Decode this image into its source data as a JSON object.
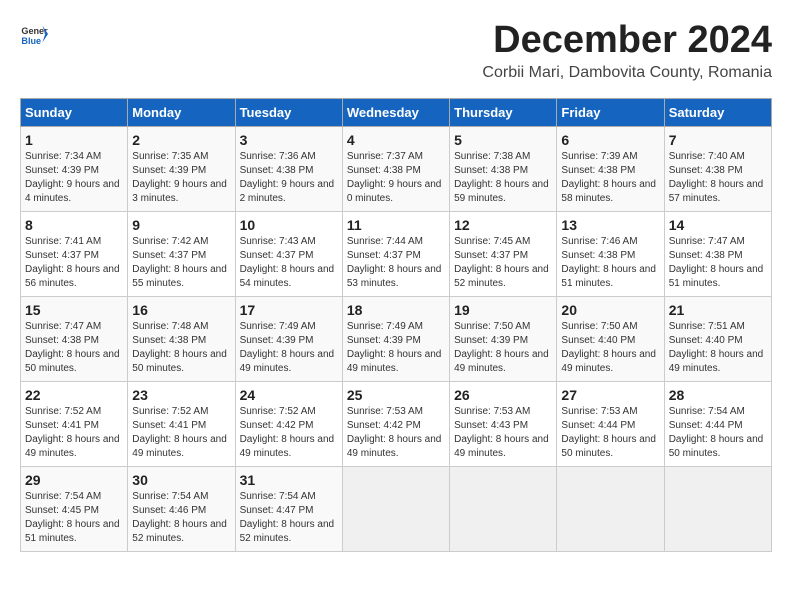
{
  "header": {
    "logo_general": "General",
    "logo_blue": "Blue",
    "month_title": "December 2024",
    "location": "Corbii Mari, Dambovita County, Romania"
  },
  "calendar": {
    "days_of_week": [
      "Sunday",
      "Monday",
      "Tuesday",
      "Wednesday",
      "Thursday",
      "Friday",
      "Saturday"
    ],
    "weeks": [
      [
        null,
        null,
        null,
        null,
        null,
        null,
        null
      ]
    ],
    "cells": [
      {
        "day": null,
        "info": null
      },
      {
        "day": null,
        "info": null
      },
      {
        "day": null,
        "info": null
      },
      {
        "day": null,
        "info": null
      },
      {
        "day": null,
        "info": null
      },
      {
        "day": null,
        "info": null
      },
      {
        "day": null,
        "info": null
      }
    ],
    "rows": [
      [
        {
          "day": "1",
          "sunrise": "Sunrise: 7:34 AM",
          "sunset": "Sunset: 4:39 PM",
          "daylight": "Daylight: 9 hours and 4 minutes."
        },
        {
          "day": "2",
          "sunrise": "Sunrise: 7:35 AM",
          "sunset": "Sunset: 4:39 PM",
          "daylight": "Daylight: 9 hours and 3 minutes."
        },
        {
          "day": "3",
          "sunrise": "Sunrise: 7:36 AM",
          "sunset": "Sunset: 4:38 PM",
          "daylight": "Daylight: 9 hours and 2 minutes."
        },
        {
          "day": "4",
          "sunrise": "Sunrise: 7:37 AM",
          "sunset": "Sunset: 4:38 PM",
          "daylight": "Daylight: 9 hours and 0 minutes."
        },
        {
          "day": "5",
          "sunrise": "Sunrise: 7:38 AM",
          "sunset": "Sunset: 4:38 PM",
          "daylight": "Daylight: 8 hours and 59 minutes."
        },
        {
          "day": "6",
          "sunrise": "Sunrise: 7:39 AM",
          "sunset": "Sunset: 4:38 PM",
          "daylight": "Daylight: 8 hours and 58 minutes."
        },
        {
          "day": "7",
          "sunrise": "Sunrise: 7:40 AM",
          "sunset": "Sunset: 4:38 PM",
          "daylight": "Daylight: 8 hours and 57 minutes."
        }
      ],
      [
        {
          "day": "8",
          "sunrise": "Sunrise: 7:41 AM",
          "sunset": "Sunset: 4:37 PM",
          "daylight": "Daylight: 8 hours and 56 minutes."
        },
        {
          "day": "9",
          "sunrise": "Sunrise: 7:42 AM",
          "sunset": "Sunset: 4:37 PM",
          "daylight": "Daylight: 8 hours and 55 minutes."
        },
        {
          "day": "10",
          "sunrise": "Sunrise: 7:43 AM",
          "sunset": "Sunset: 4:37 PM",
          "daylight": "Daylight: 8 hours and 54 minutes."
        },
        {
          "day": "11",
          "sunrise": "Sunrise: 7:44 AM",
          "sunset": "Sunset: 4:37 PM",
          "daylight": "Daylight: 8 hours and 53 minutes."
        },
        {
          "day": "12",
          "sunrise": "Sunrise: 7:45 AM",
          "sunset": "Sunset: 4:37 PM",
          "daylight": "Daylight: 8 hours and 52 minutes."
        },
        {
          "day": "13",
          "sunrise": "Sunrise: 7:46 AM",
          "sunset": "Sunset: 4:38 PM",
          "daylight": "Daylight: 8 hours and 51 minutes."
        },
        {
          "day": "14",
          "sunrise": "Sunrise: 7:47 AM",
          "sunset": "Sunset: 4:38 PM",
          "daylight": "Daylight: 8 hours and 51 minutes."
        }
      ],
      [
        {
          "day": "15",
          "sunrise": "Sunrise: 7:47 AM",
          "sunset": "Sunset: 4:38 PM",
          "daylight": "Daylight: 8 hours and 50 minutes."
        },
        {
          "day": "16",
          "sunrise": "Sunrise: 7:48 AM",
          "sunset": "Sunset: 4:38 PM",
          "daylight": "Daylight: 8 hours and 50 minutes."
        },
        {
          "day": "17",
          "sunrise": "Sunrise: 7:49 AM",
          "sunset": "Sunset: 4:39 PM",
          "daylight": "Daylight: 8 hours and 49 minutes."
        },
        {
          "day": "18",
          "sunrise": "Sunrise: 7:49 AM",
          "sunset": "Sunset: 4:39 PM",
          "daylight": "Daylight: 8 hours and 49 minutes."
        },
        {
          "day": "19",
          "sunrise": "Sunrise: 7:50 AM",
          "sunset": "Sunset: 4:39 PM",
          "daylight": "Daylight: 8 hours and 49 minutes."
        },
        {
          "day": "20",
          "sunrise": "Sunrise: 7:50 AM",
          "sunset": "Sunset: 4:40 PM",
          "daylight": "Daylight: 8 hours and 49 minutes."
        },
        {
          "day": "21",
          "sunrise": "Sunrise: 7:51 AM",
          "sunset": "Sunset: 4:40 PM",
          "daylight": "Daylight: 8 hours and 49 minutes."
        }
      ],
      [
        {
          "day": "22",
          "sunrise": "Sunrise: 7:52 AM",
          "sunset": "Sunset: 4:41 PM",
          "daylight": "Daylight: 8 hours and 49 minutes."
        },
        {
          "day": "23",
          "sunrise": "Sunrise: 7:52 AM",
          "sunset": "Sunset: 4:41 PM",
          "daylight": "Daylight: 8 hours and 49 minutes."
        },
        {
          "day": "24",
          "sunrise": "Sunrise: 7:52 AM",
          "sunset": "Sunset: 4:42 PM",
          "daylight": "Daylight: 8 hours and 49 minutes."
        },
        {
          "day": "25",
          "sunrise": "Sunrise: 7:53 AM",
          "sunset": "Sunset: 4:42 PM",
          "daylight": "Daylight: 8 hours and 49 minutes."
        },
        {
          "day": "26",
          "sunrise": "Sunrise: 7:53 AM",
          "sunset": "Sunset: 4:43 PM",
          "daylight": "Daylight: 8 hours and 49 minutes."
        },
        {
          "day": "27",
          "sunrise": "Sunrise: 7:53 AM",
          "sunset": "Sunset: 4:44 PM",
          "daylight": "Daylight: 8 hours and 50 minutes."
        },
        {
          "day": "28",
          "sunrise": "Sunrise: 7:54 AM",
          "sunset": "Sunset: 4:44 PM",
          "daylight": "Daylight: 8 hours and 50 minutes."
        }
      ],
      [
        {
          "day": "29",
          "sunrise": "Sunrise: 7:54 AM",
          "sunset": "Sunset: 4:45 PM",
          "daylight": "Daylight: 8 hours and 51 minutes."
        },
        {
          "day": "30",
          "sunrise": "Sunrise: 7:54 AM",
          "sunset": "Sunset: 4:46 PM",
          "daylight": "Daylight: 8 hours and 52 minutes."
        },
        {
          "day": "31",
          "sunrise": "Sunrise: 7:54 AM",
          "sunset": "Sunset: 4:47 PM",
          "daylight": "Daylight: 8 hours and 52 minutes."
        },
        null,
        null,
        null,
        null
      ]
    ]
  }
}
